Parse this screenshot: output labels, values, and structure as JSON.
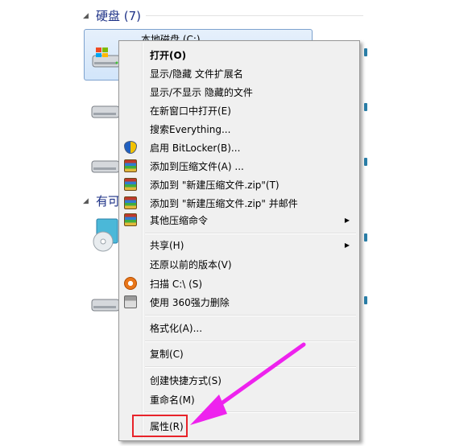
{
  "explorer": {
    "hdd_group": "硬盘 (7)",
    "removable_group_partial": "有可",
    "selected_drive_label": "本地磁盘 (C:)"
  },
  "context_menu": {
    "items": [
      {
        "label": "打开(O)",
        "bold": true,
        "icon": null,
        "submenu": false
      },
      {
        "label": "显示/隐藏 文件扩展名",
        "icon": null,
        "submenu": false
      },
      {
        "label": "显示/不显示 隐藏的文件",
        "icon": null,
        "submenu": false
      },
      {
        "label": "在新窗口中打开(E)",
        "icon": null,
        "submenu": false
      },
      {
        "label": "搜索Everything...",
        "icon": null,
        "submenu": false
      },
      {
        "label": "启用 BitLocker(B)...",
        "icon": "shield-icon",
        "submenu": false
      },
      {
        "label": "添加到压缩文件(A) ...",
        "icon": "archive-icon",
        "submenu": false
      },
      {
        "label": "添加到 \"新建压缩文件.zip\"(T)",
        "icon": "archive-icon",
        "submenu": false
      },
      {
        "label": "添加到 \"新建压缩文件.zip\" 并邮件",
        "icon": "archive-icon",
        "submenu": false
      },
      {
        "label": "其他压缩命令",
        "icon": "archive-icon",
        "submenu": true
      },
      {
        "label": "共享(H)",
        "icon": null,
        "submenu": true
      },
      {
        "label": "还原以前的版本(V)",
        "icon": null,
        "submenu": false
      },
      {
        "label": "扫描 C:\\ (S)",
        "icon": "360-scan-icon",
        "submenu": false
      },
      {
        "label": "使用 360强力删除",
        "icon": "shredder-icon",
        "submenu": false
      },
      {
        "label": "格式化(A)...",
        "icon": null,
        "submenu": false
      },
      {
        "label": "复制(C)",
        "icon": null,
        "submenu": false
      },
      {
        "label": "创建快捷方式(S)",
        "icon": null,
        "submenu": false
      },
      {
        "label": "重命名(M)",
        "icon": null,
        "submenu": false
      },
      {
        "label": "属性(R)",
        "icon": null,
        "submenu": false
      }
    ]
  },
  "annotation": {
    "highlight_color": "#e8232a",
    "arrow_color": "#ee22ee"
  }
}
